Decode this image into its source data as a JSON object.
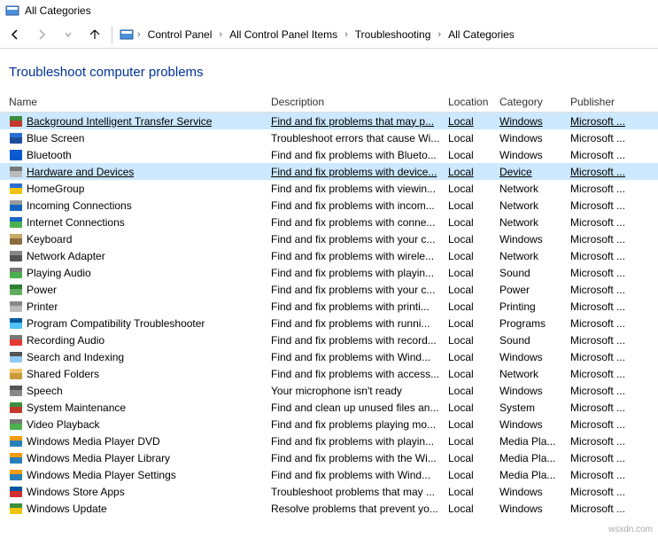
{
  "window": {
    "title": "All Categories"
  },
  "breadcrumbs": [
    "Control Panel",
    "All Control Panel Items",
    "Troubleshooting",
    "All Categories"
  ],
  "heading": "Troubleshoot computer problems",
  "columns": {
    "name": "Name",
    "description": "Description",
    "location": "Location",
    "category": "Category",
    "publisher": "Publisher"
  },
  "watermark": "wsxdn.com",
  "rows": [
    {
      "name": "Background Intelligent Transfer Service",
      "description": "Find and fix problems that may p...",
      "location": "Local",
      "category": "Windows",
      "publisher": "Microsoft ...",
      "selected": true,
      "icon_colors": [
        "#3b8e3b",
        "#c0392b"
      ]
    },
    {
      "name": "Blue Screen",
      "description": "Troubleshoot errors that cause Wi...",
      "location": "Local",
      "category": "Windows",
      "publisher": "Microsoft ...",
      "icon_colors": [
        "#2a6fd6",
        "#1e4e9c"
      ]
    },
    {
      "name": "Bluetooth",
      "description": "Find and fix problems with Blueto...",
      "location": "Local",
      "category": "Windows",
      "publisher": "Microsoft ...",
      "icon_colors": [
        "#0a5bd1",
        "#0a5bd1"
      ]
    },
    {
      "name": "Hardware and Devices",
      "description": "Find and fix problems with device...",
      "location": "Local",
      "category": "Device",
      "publisher": "Microsoft ...",
      "selected": true,
      "icon_colors": [
        "#777",
        "#bbb"
      ]
    },
    {
      "name": "HomeGroup",
      "description": "Find and fix problems with viewin...",
      "location": "Local",
      "category": "Network",
      "publisher": "Microsoft ...",
      "icon_colors": [
        "#2a6fd6",
        "#f1c40f"
      ]
    },
    {
      "name": "Incoming Connections",
      "description": "Find and fix problems with incom...",
      "location": "Local",
      "category": "Network",
      "publisher": "Microsoft ...",
      "icon_colors": [
        "#999",
        "#1565c0"
      ]
    },
    {
      "name": "Internet Connections",
      "description": "Find and fix problems with conne...",
      "location": "Local",
      "category": "Network",
      "publisher": "Microsoft ...",
      "icon_colors": [
        "#1565c0",
        "#4caf50"
      ]
    },
    {
      "name": "Keyboard",
      "description": "Find and fix problems with your c...",
      "location": "Local",
      "category": "Windows",
      "publisher": "Microsoft ...",
      "icon_colors": [
        "#c9a86a",
        "#8b6c3e"
      ]
    },
    {
      "name": "Network Adapter",
      "description": "Find and fix problems with wirele...",
      "location": "Local",
      "category": "Network",
      "publisher": "Microsoft ...",
      "icon_colors": [
        "#888",
        "#555"
      ]
    },
    {
      "name": "Playing Audio",
      "description": "Find and fix problems with playin...",
      "location": "Local",
      "category": "Sound",
      "publisher": "Microsoft ...",
      "icon_colors": [
        "#777",
        "#4caf50"
      ]
    },
    {
      "name": "Power",
      "description": "Find and fix problems with your c...",
      "location": "Local",
      "category": "Power",
      "publisher": "Microsoft ...",
      "icon_colors": [
        "#2e7d32",
        "#60ad5e"
      ]
    },
    {
      "name": "Printer",
      "description": "Find and fix problems with printi...",
      "location": "Local",
      "category": "Printing",
      "publisher": "Microsoft ...",
      "icon_colors": [
        "#888",
        "#bbb"
      ]
    },
    {
      "name": "Program Compatibility Troubleshooter",
      "description": "Find and fix problems with runni...",
      "location": "Local",
      "category": "Programs",
      "publisher": "Microsoft ...",
      "icon_colors": [
        "#01579b",
        "#4fc3f7"
      ]
    },
    {
      "name": "Recording Audio",
      "description": "Find and fix problems with record...",
      "location": "Local",
      "category": "Sound",
      "publisher": "Microsoft ...",
      "icon_colors": [
        "#777",
        "#e53935"
      ]
    },
    {
      "name": "Search and Indexing",
      "description": "Find and fix problems with Wind...",
      "location": "Local",
      "category": "Windows",
      "publisher": "Microsoft ...",
      "icon_colors": [
        "#555",
        "#90caf9"
      ]
    },
    {
      "name": "Shared Folders",
      "description": "Find and fix problems with access...",
      "location": "Local",
      "category": "Network",
      "publisher": "Microsoft ...",
      "icon_colors": [
        "#f1c36b",
        "#c79a3a"
      ]
    },
    {
      "name": "Speech",
      "description": "Your microphone isn't ready",
      "location": "Local",
      "category": "Windows",
      "publisher": "Microsoft ...",
      "icon_colors": [
        "#555",
        "#888"
      ]
    },
    {
      "name": "System Maintenance",
      "description": "Find and clean up unused files an...",
      "location": "Local",
      "category": "System",
      "publisher": "Microsoft ...",
      "icon_colors": [
        "#3b8e3b",
        "#c0392b"
      ]
    },
    {
      "name": "Video Playback",
      "description": "Find and fix problems playing mo...",
      "location": "Local",
      "category": "Windows",
      "publisher": "Microsoft ...",
      "icon_colors": [
        "#777",
        "#4caf50"
      ]
    },
    {
      "name": "Windows Media Player DVD",
      "description": "Find and fix problems with playin...",
      "location": "Local",
      "category": "Media Pla...",
      "publisher": "Microsoft ...",
      "icon_colors": [
        "#f39c12",
        "#2980b9"
      ]
    },
    {
      "name": "Windows Media Player Library",
      "description": "Find and fix problems with the Wi...",
      "location": "Local",
      "category": "Media Pla...",
      "publisher": "Microsoft ...",
      "icon_colors": [
        "#f39c12",
        "#2980b9"
      ]
    },
    {
      "name": "Windows Media Player Settings",
      "description": "Find and fix problems with Wind...",
      "location": "Local",
      "category": "Media Pla...",
      "publisher": "Microsoft ...",
      "icon_colors": [
        "#f39c12",
        "#2980b9"
      ]
    },
    {
      "name": "Windows Store Apps",
      "description": "Troubleshoot problems that may ...",
      "location": "Local",
      "category": "Windows",
      "publisher": "Microsoft ...",
      "icon_colors": [
        "#01579b",
        "#d32f2f"
      ]
    },
    {
      "name": "Windows Update",
      "description": "Resolve problems that prevent yo...",
      "location": "Local",
      "category": "Windows",
      "publisher": "Microsoft ...",
      "icon_colors": [
        "#3b8e3b",
        "#f1c40f"
      ]
    }
  ]
}
